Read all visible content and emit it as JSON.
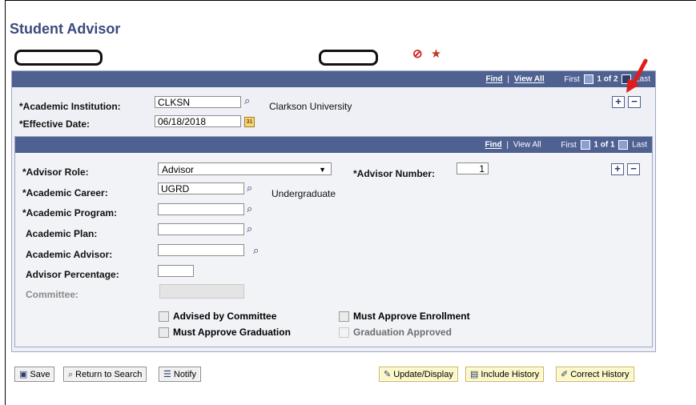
{
  "page": {
    "title": "Student Advisor"
  },
  "top_icons": {
    "no_symbol": "⊘",
    "star": "★"
  },
  "outer_header": {
    "find": "Find",
    "separator": "|",
    "view_all": "View All",
    "first": "First",
    "counter": "1 of 2",
    "last": "Last"
  },
  "institution": {
    "label": "*Academic Institution:",
    "value": "CLKSN",
    "description": "Clarkson University"
  },
  "effective_date": {
    "label": "*Effective Date:",
    "value": "06/18/2018",
    "cal_text": "31"
  },
  "inner_header": {
    "find": "Find",
    "separator": "|",
    "view_all": "View All",
    "first": "First",
    "counter": "1 of 1",
    "last": "Last"
  },
  "advisor_role": {
    "label": "*Advisor Role:",
    "value": "Advisor",
    "arrow": "▼"
  },
  "advisor_number": {
    "label": "*Advisor Number:",
    "value": "1"
  },
  "academic_career": {
    "label": "*Academic Career:",
    "value": "UGRD",
    "description": "Undergraduate"
  },
  "academic_program": {
    "label": "*Academic Program:",
    "value": ""
  },
  "academic_plan": {
    "label": "Academic Plan:",
    "value": ""
  },
  "academic_advisor": {
    "label": "Academic Advisor:",
    "value": ""
  },
  "advisor_percentage": {
    "label": "Advisor Percentage:",
    "value": ""
  },
  "committee": {
    "label": "Committee:",
    "value": ""
  },
  "checkboxes": {
    "advised_by_committee": "Advised by Committee",
    "must_approve_enrollment": "Must Approve Enrollment",
    "must_approve_graduation": "Must Approve Graduation",
    "graduation_approved": "Graduation Approved"
  },
  "row_controls": {
    "add": "+",
    "remove": "−"
  },
  "lookup_glyph": "🔍",
  "buttons": {
    "save": "Save",
    "return_to_search": "Return to Search",
    "notify": "Notify",
    "update_display": "Update/Display",
    "include_history": "Include History",
    "correct_history": "Correct History"
  },
  "colors": {
    "header_bar": "#4e6191",
    "title": "#3d4a7d",
    "annotation_arrow": "#e21b1b"
  }
}
